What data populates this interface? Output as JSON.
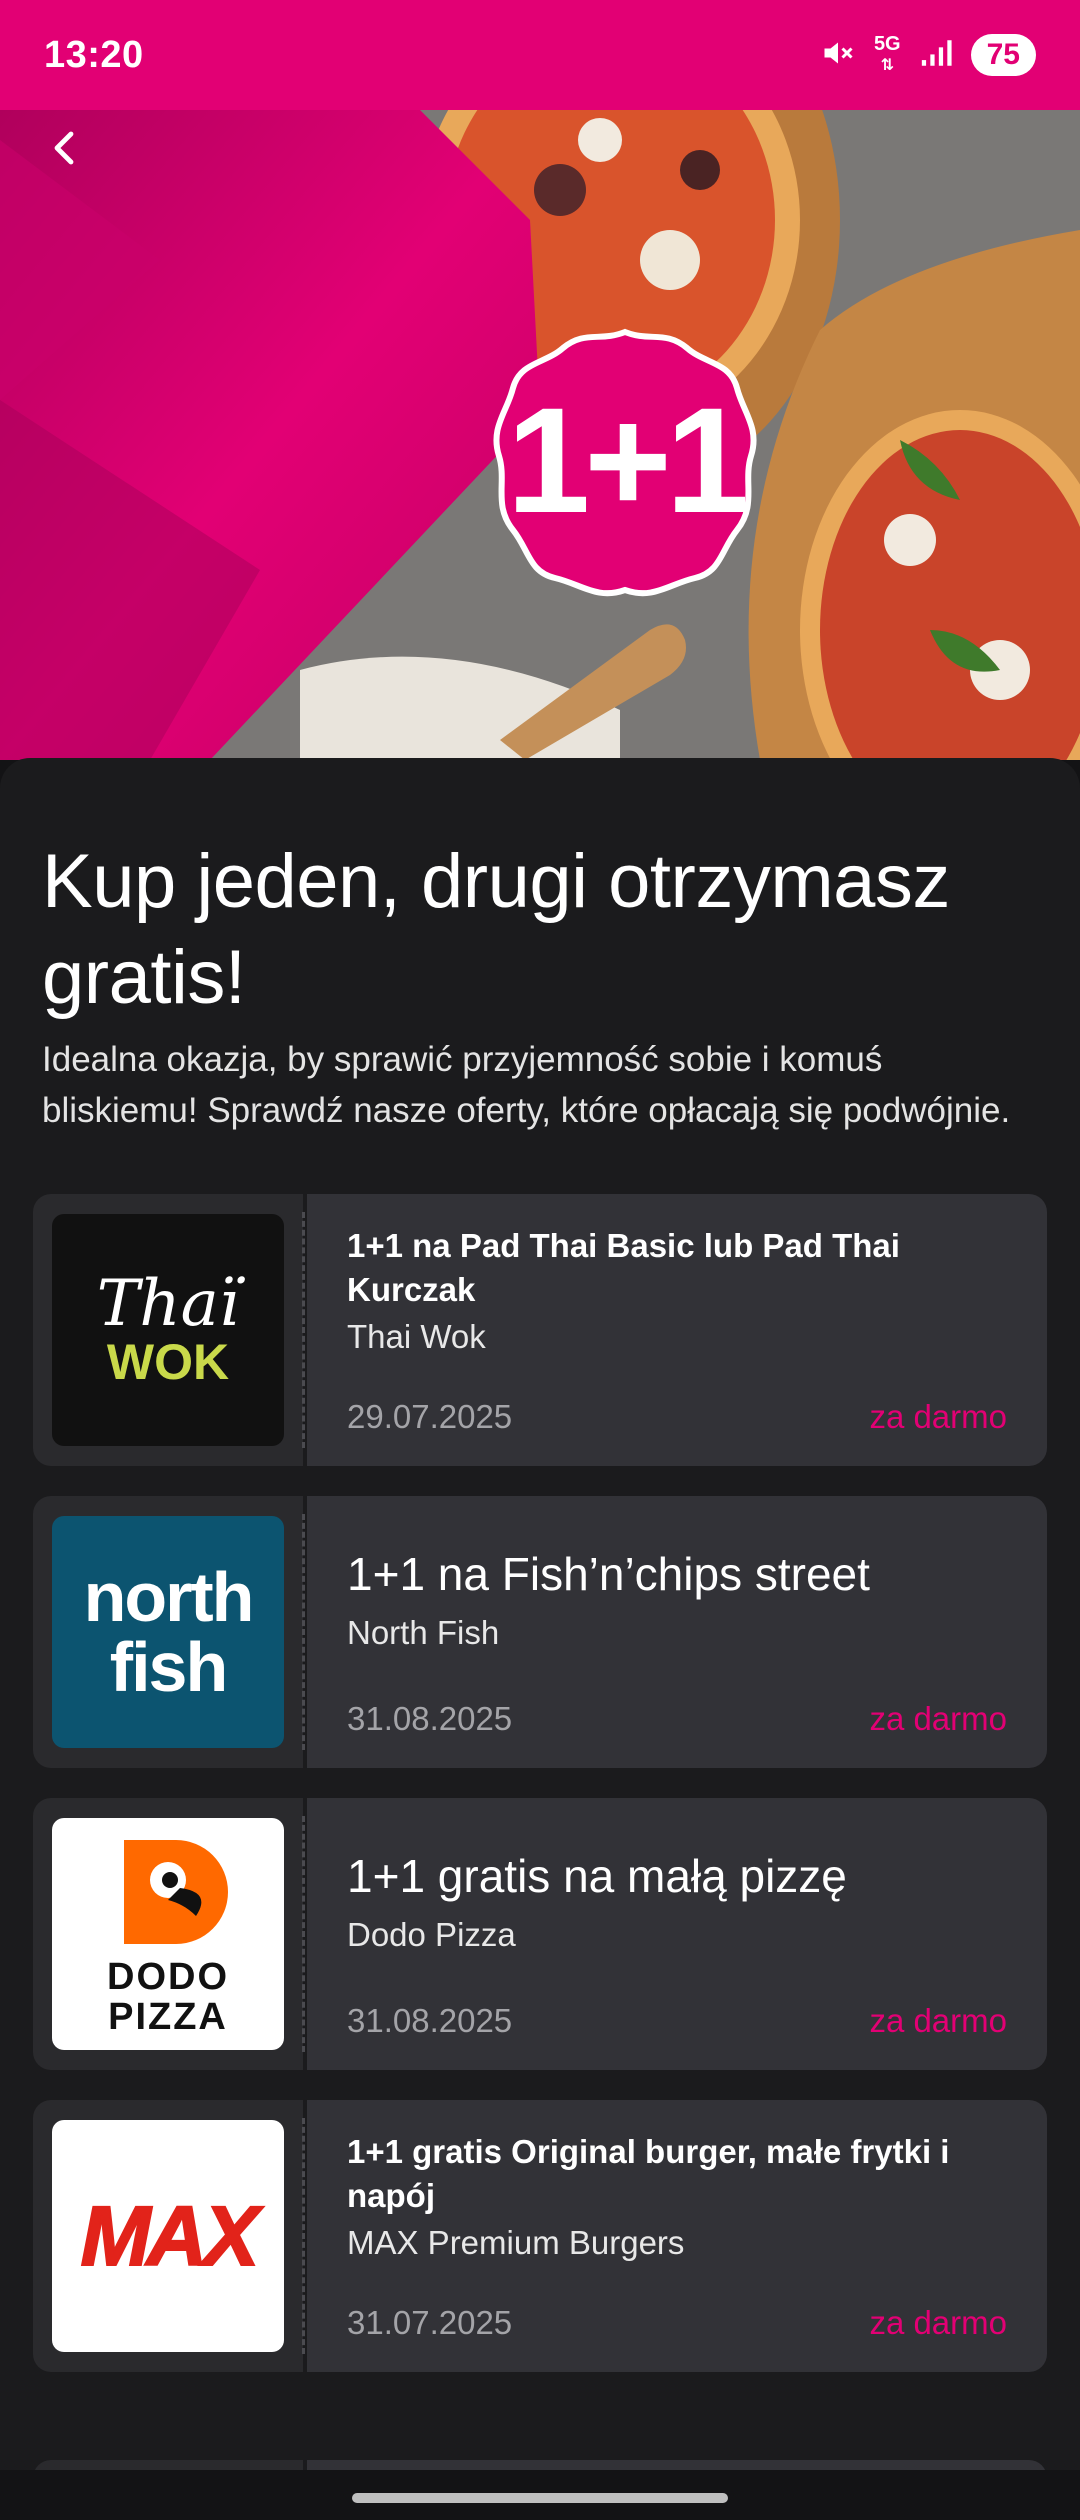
{
  "status_bar": {
    "time": "13:20",
    "network": "5G",
    "battery": "75"
  },
  "hero": {
    "badge": "1+1"
  },
  "page": {
    "title": "Kup jeden, drugi otrzymasz gratis!",
    "subtitle": "Idealna okazja, by sprawić przyjemność sobie i komuś bliskiemu! Sprawdź nasze oferty, które opłacają się podwójnie."
  },
  "offers": [
    {
      "title": "1+1 na Pad Thai Basic lub Pad Thai Kurczak",
      "brand": "Thai Wok",
      "date": "29.07.2025",
      "price": "za darmo",
      "logo_text": [
        "Thaï",
        "WOK"
      ]
    },
    {
      "title": "1+1 na Fish’n’chips street",
      "brand": "North Fish",
      "date": "31.08.2025",
      "price": "za darmo",
      "logo_text": [
        "north",
        "fish"
      ]
    },
    {
      "title": "1+1 gratis na małą pizzę",
      "brand": "Dodo Pizza",
      "date": "31.08.2025",
      "price": "za darmo",
      "logo_text": [
        "DODO",
        "PIZZA"
      ]
    },
    {
      "title": "1+1 gratis Original burger, małe frytki i napój",
      "brand": "MAX Premium Burgers",
      "date": "31.07.2025",
      "price": "za darmo",
      "logo_text": [
        "MAX"
      ]
    }
  ],
  "colors": {
    "accent": "#e20074",
    "background": "#1b1b1d",
    "card": "#323237"
  }
}
